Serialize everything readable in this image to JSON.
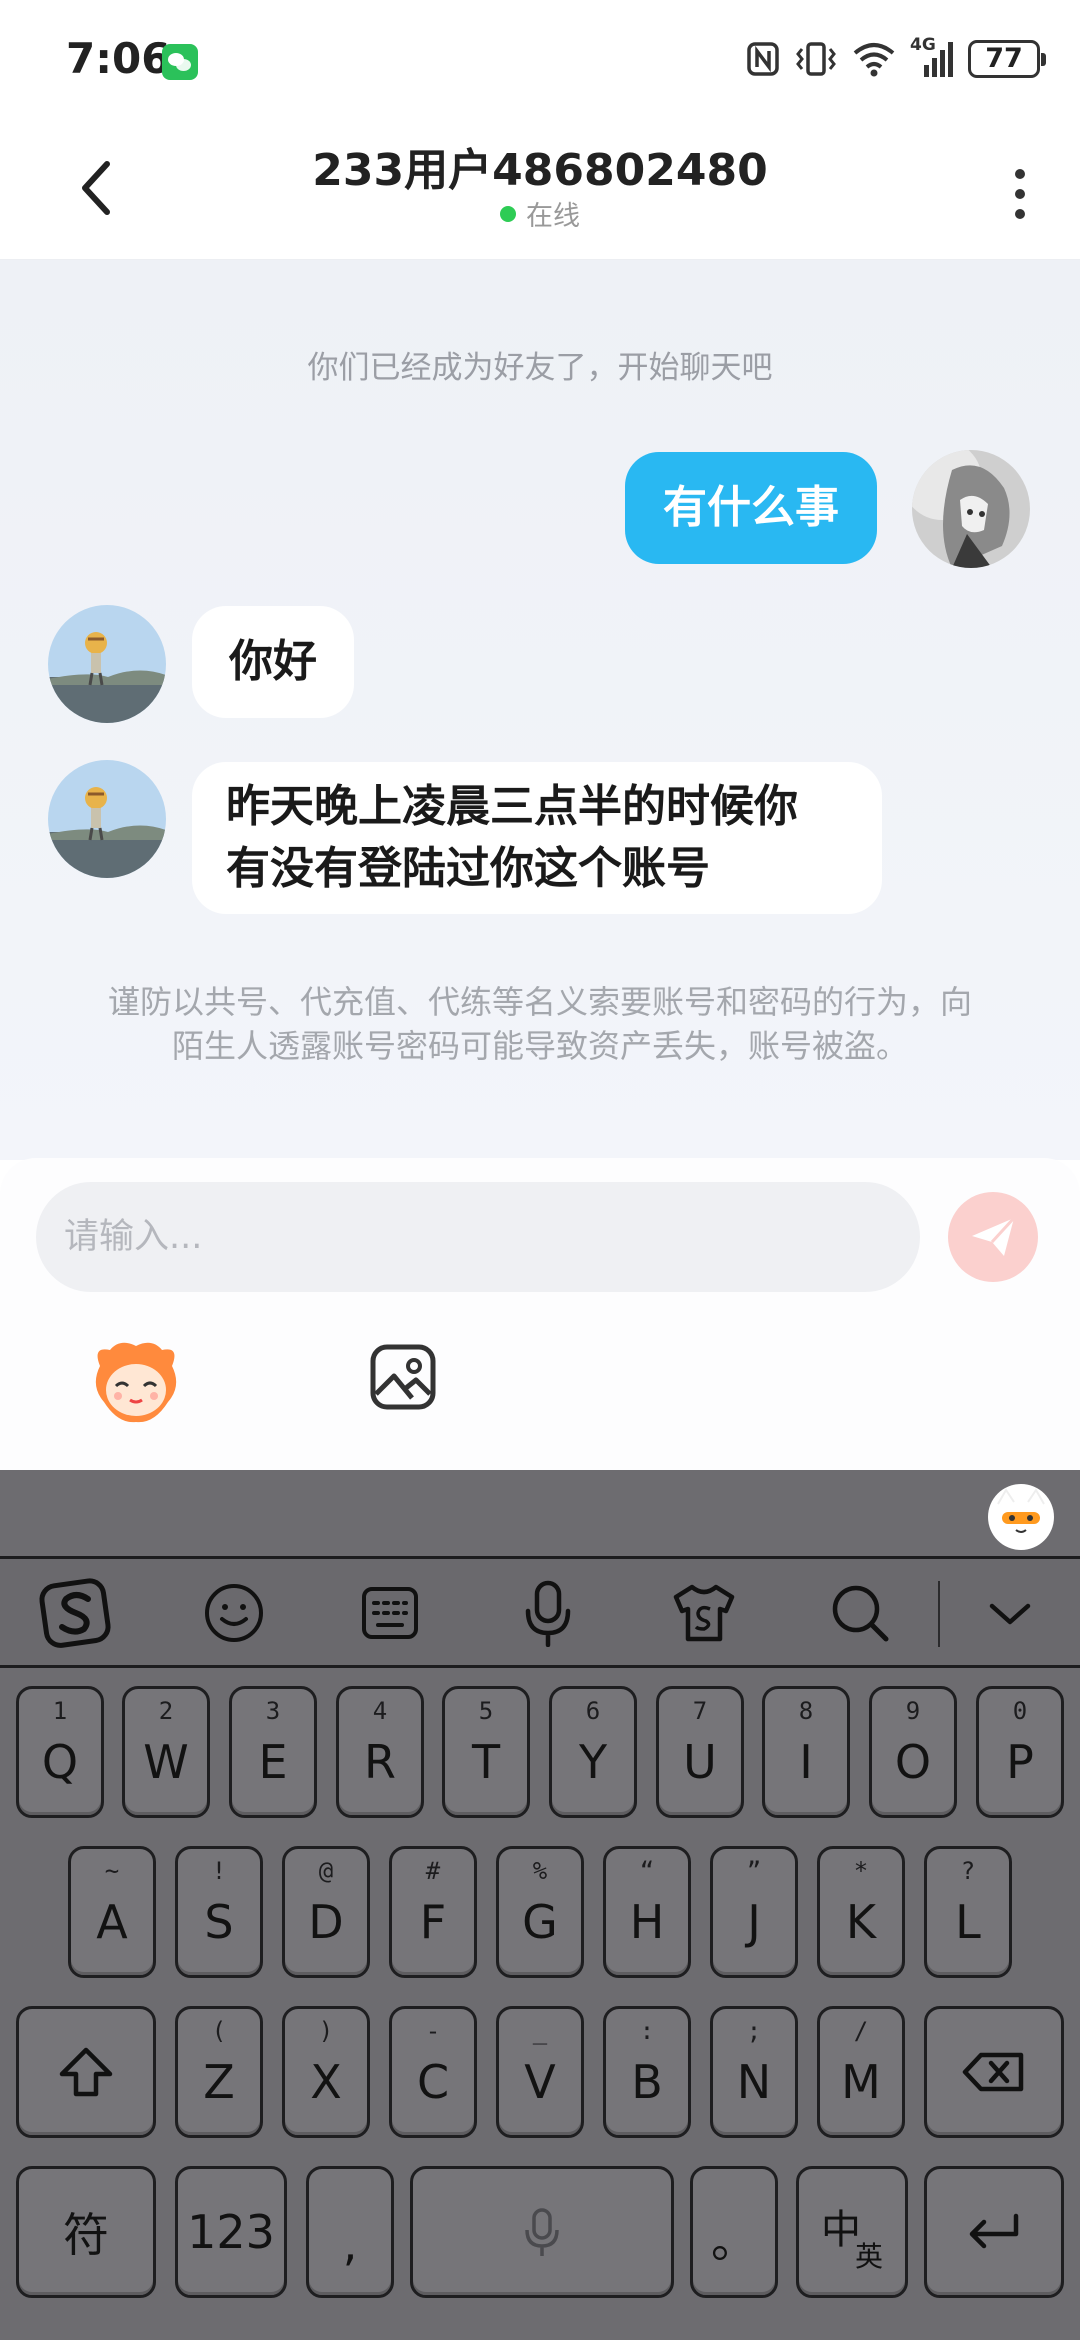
{
  "status_bar": {
    "time": "7:06",
    "network": "4G",
    "battery": "77"
  },
  "header": {
    "title": "233用户486802480",
    "status": "在线"
  },
  "chat": {
    "system_note": "你们已经成为好友了，开始聊天吧",
    "messages": [
      {
        "side": "right",
        "text": "有什么事"
      },
      {
        "side": "left",
        "text": "你好"
      },
      {
        "side": "left",
        "line1": "昨天晚上凌晨三点半的时候你",
        "line2": "有没有登陆过你这个账号"
      }
    ],
    "warning": "谨防以共号、代充值、代练等名义索要账号和密码的行为，向陌生人透露账号密码可能导致资产丢失，账号被盗。"
  },
  "input": {
    "placeholder": "请输入..."
  },
  "keyboard": {
    "row1": [
      {
        "hint": "1",
        "key": "Q"
      },
      {
        "hint": "2",
        "key": "W"
      },
      {
        "hint": "3",
        "key": "E"
      },
      {
        "hint": "4",
        "key": "R"
      },
      {
        "hint": "5",
        "key": "T"
      },
      {
        "hint": "6",
        "key": "Y"
      },
      {
        "hint": "7",
        "key": "U"
      },
      {
        "hint": "8",
        "key": "I"
      },
      {
        "hint": "9",
        "key": "O"
      },
      {
        "hint": "0",
        "key": "P"
      }
    ],
    "row2": [
      {
        "hint": "~",
        "key": "A"
      },
      {
        "hint": "!",
        "key": "S"
      },
      {
        "hint": "@",
        "key": "D"
      },
      {
        "hint": "#",
        "key": "F"
      },
      {
        "hint": "%",
        "key": "G"
      },
      {
        "hint": "“",
        "key": "H"
      },
      {
        "hint": "”",
        "key": "J"
      },
      {
        "hint": "*",
        "key": "K"
      },
      {
        "hint": "?",
        "key": "L"
      }
    ],
    "row3": [
      {
        "hint": "(",
        "key": "Z"
      },
      {
        "hint": ")",
        "key": "X"
      },
      {
        "hint": "-",
        "key": "C"
      },
      {
        "hint": "_",
        "key": "V"
      },
      {
        "hint": ":",
        "key": "B"
      },
      {
        "hint": ";",
        "key": "N"
      },
      {
        "hint": "/",
        "key": "M"
      }
    ],
    "bottom": {
      "symbols": "符",
      "numbers": "123",
      "comma": ",",
      "period": "。",
      "lang_main": "中",
      "lang_sub": "英"
    }
  },
  "colors": {
    "accent_blue": "#29b8f2",
    "online_green": "#2ecc55",
    "send_button_disabled": "#fbd0ce",
    "keyboard_bg": "#6d6c70"
  }
}
